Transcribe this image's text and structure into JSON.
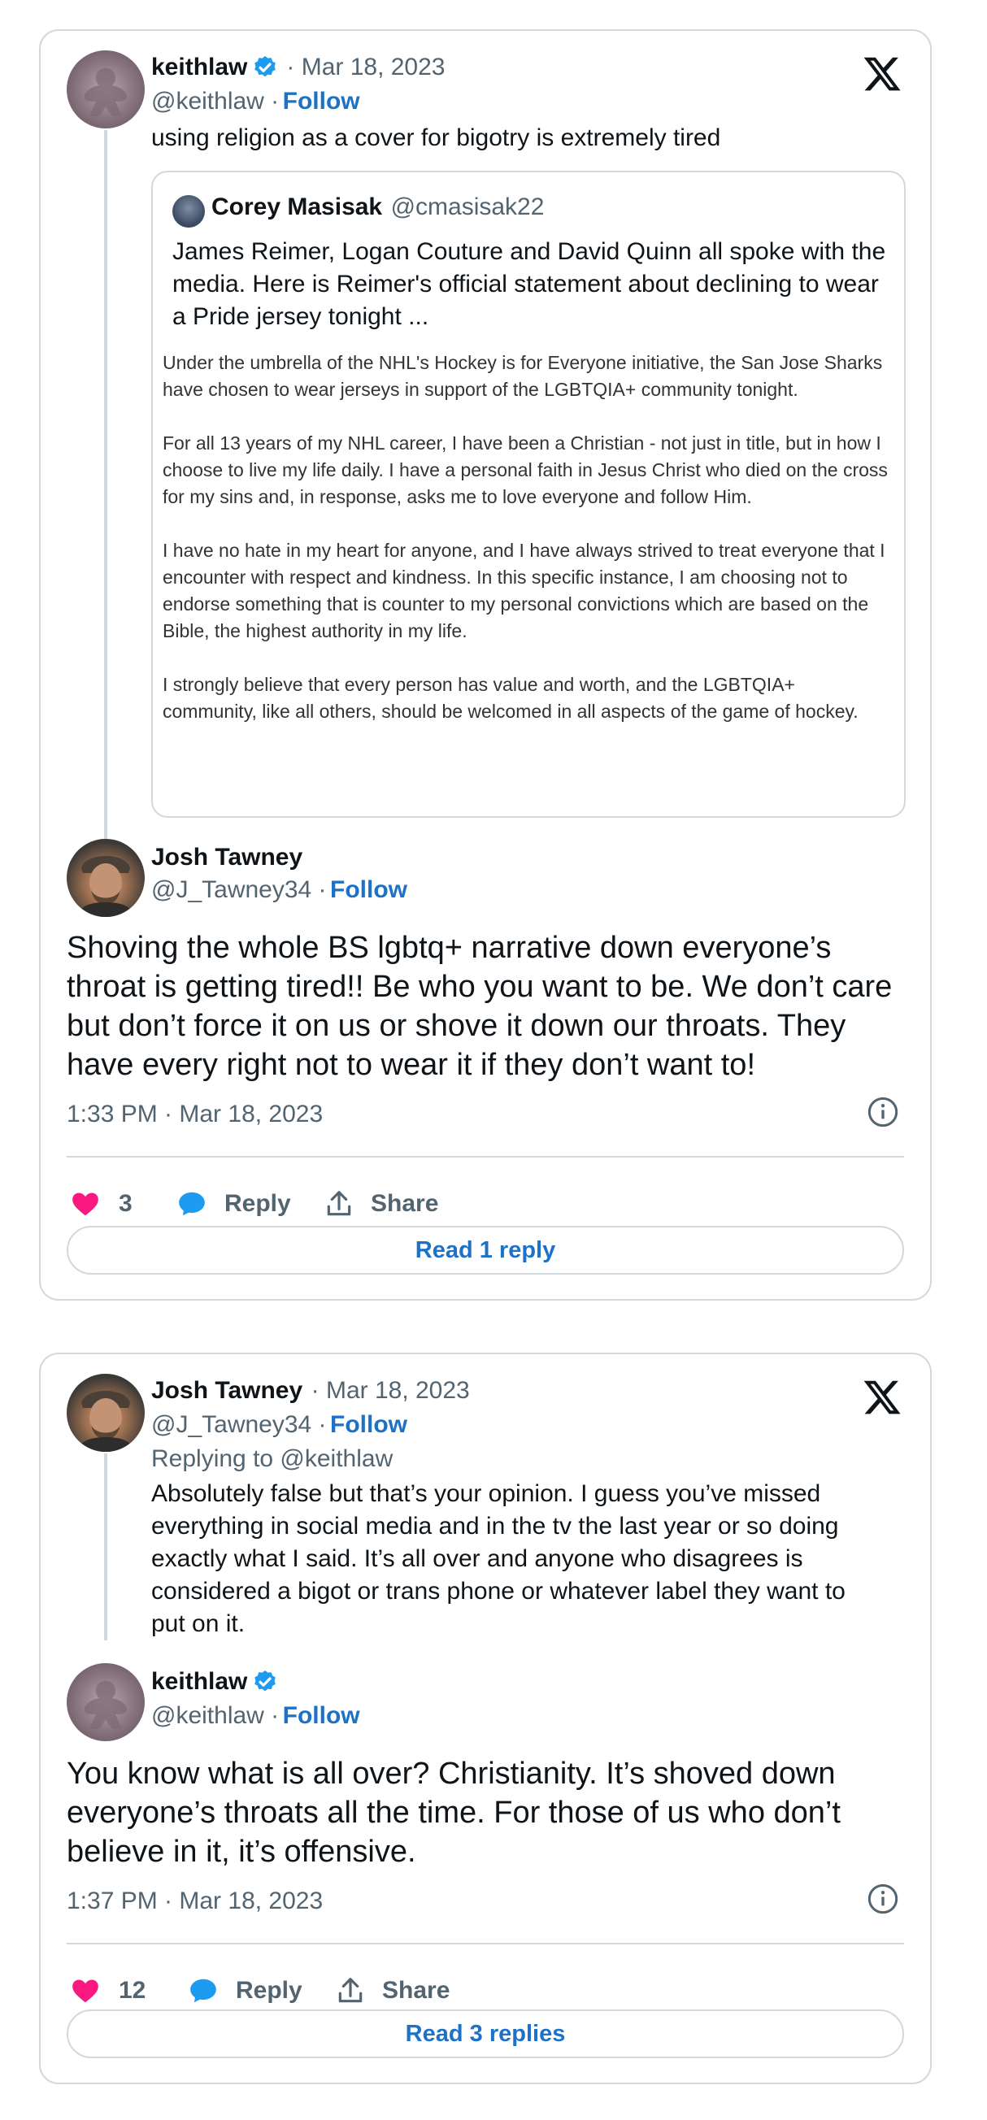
{
  "card1": {
    "tweet": {
      "name": "keithlaw",
      "date": "· Mar 18, 2023",
      "handle": "@keithlaw ·",
      "follow": "Follow",
      "text": "using religion as a cover for bigotry is extremely tired"
    },
    "quote": {
      "name": "Corey Masisak",
      "handle": "@cmasisak22",
      "text": "James Reimer, Logan Couture and David Quinn all spoke with the media. Here is Reimer's official statement about declining to wear a Pride jersey tonight ...",
      "image_paragraphs": [
        "Under the umbrella of the NHL's Hockey is for Everyone initiative, the San Jose Sharks have chosen to wear jerseys in support of the LGBTQIA+ community tonight.",
        "For all 13 years of my NHL career, I have been a Christian - not just in title, but in how I choose to live my life daily. I have a personal faith in Jesus Christ who died on the cross for my sins and, in response, asks me to love everyone and follow Him.",
        "I have no hate in my heart for anyone, and I have always strived to treat everyone that I encounter with respect and kindness. In this specific instance, I am choosing not to endorse something that is counter to my personal convictions which are based on the Bible, the highest authority in my life.",
        "I strongly believe that every person has value and worth, and the LGBTQIA+ community, like all others, should be welcomed in all aspects of the game of hockey."
      ]
    },
    "reply": {
      "name": "Josh Tawney",
      "handle": "@J_Tawney34 ·",
      "follow": "Follow",
      "text": "Shoving the whole BS lgbtq+ narrative down everyone’s throat is getting tired!! Be who you want to be. We don’t care but don’t force it on us or shove it down our throats. They have every right not to wear it if they don’t want to!",
      "timestamp": "1:33 PM · Mar 18, 2023",
      "likes": "3",
      "reply_label": "Reply",
      "share_label": "Share",
      "read_replies": "Read 1 reply"
    }
  },
  "card2": {
    "tweet": {
      "name": "Josh Tawney",
      "date": "· Mar 18, 2023",
      "handle": "@J_Tawney34 ·",
      "follow": "Follow",
      "replying_to": "Replying to @keithlaw",
      "text": "Absolutely false but that’s your opinion. I guess you’ve missed everything in social media and in the tv the last year or so doing exactly what I said. It’s all over and anyone who disagrees is considered a bigot or trans phone or whatever label they want to put on it."
    },
    "reply": {
      "name": "keithlaw",
      "handle": "@keithlaw ·",
      "follow": "Follow",
      "text": "You know what is all over? Christianity. It’s shoved down everyone’s throats all the time. For those of us who don’t believe in it, it’s offensive.",
      "timestamp": "1:37 PM · Mar 18, 2023",
      "likes": "12",
      "reply_label": "Reply",
      "share_label": "Share",
      "read_replies": "Read 3 replies"
    }
  },
  "colors": {
    "heart": "#f91880",
    "reply_bubble": "#1d9bf0",
    "link": "#1d72c7",
    "verified": "#1d9bf0",
    "border": "#cfd9de",
    "secondary_text": "#536471"
  },
  "icons": [
    "x-logo-icon",
    "verified-badge-icon",
    "heart-icon",
    "reply-bubble-icon",
    "share-icon",
    "info-icon"
  ]
}
